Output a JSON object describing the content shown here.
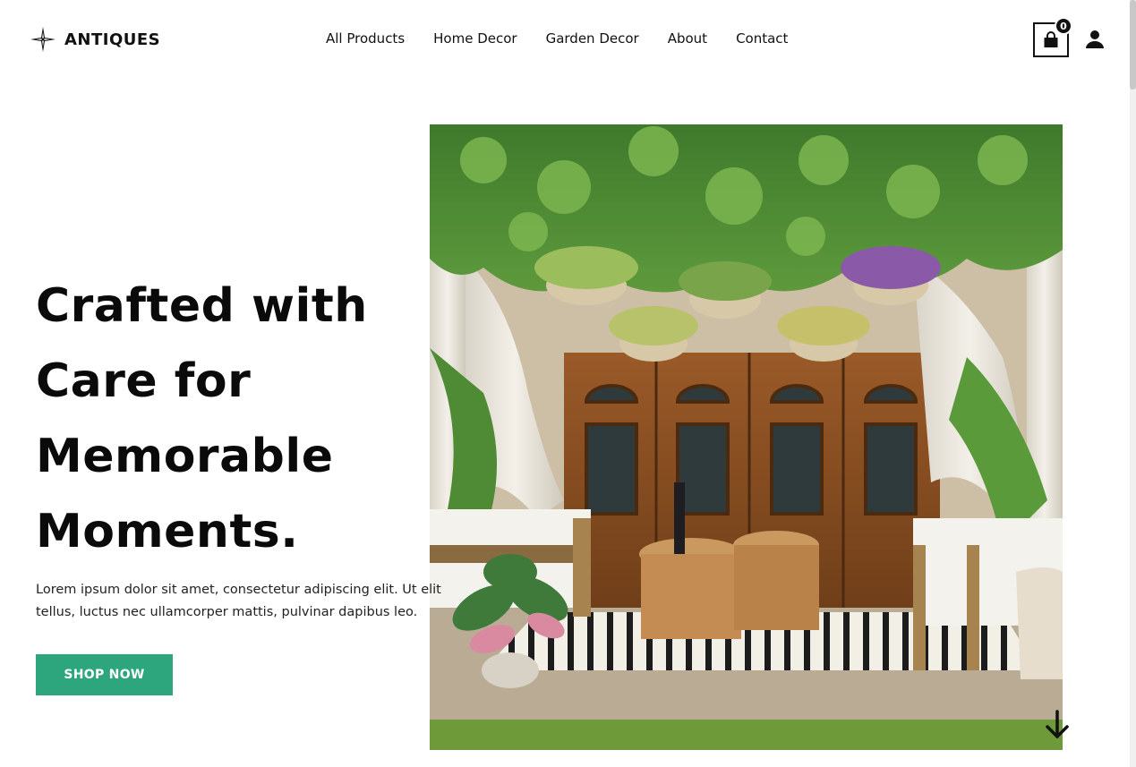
{
  "brand": {
    "name": "ANTIQUES",
    "logo_icon": "compass-star-icon"
  },
  "nav": {
    "items": [
      {
        "label": "All Products"
      },
      {
        "label": "Home Decor"
      },
      {
        "label": "Garden Decor"
      },
      {
        "label": "About"
      },
      {
        "label": "Contact"
      }
    ]
  },
  "cart": {
    "count": "0",
    "icon": "shopping-bag-icon"
  },
  "user": {
    "icon": "user-icon"
  },
  "hero": {
    "title_lines": [
      "Crafted with",
      "Care for",
      "Memorable",
      "Moments."
    ],
    "description_lines": [
      "Lorem ipsum dolor sit amet, consectetur adipiscing elit. Ut elit",
      "tellus, luctus nec ullamcorper mattis, pulvinar dapibus leo."
    ],
    "cta_label": "SHOP NOW",
    "image_subject": "garden patio with hanging flower baskets, wooden doors, wicker stools and striped rug",
    "scroll_icon": "arrow-down-icon"
  },
  "colors": {
    "accent": "#2da67e",
    "text": "#111111",
    "background": "#ffffff"
  }
}
